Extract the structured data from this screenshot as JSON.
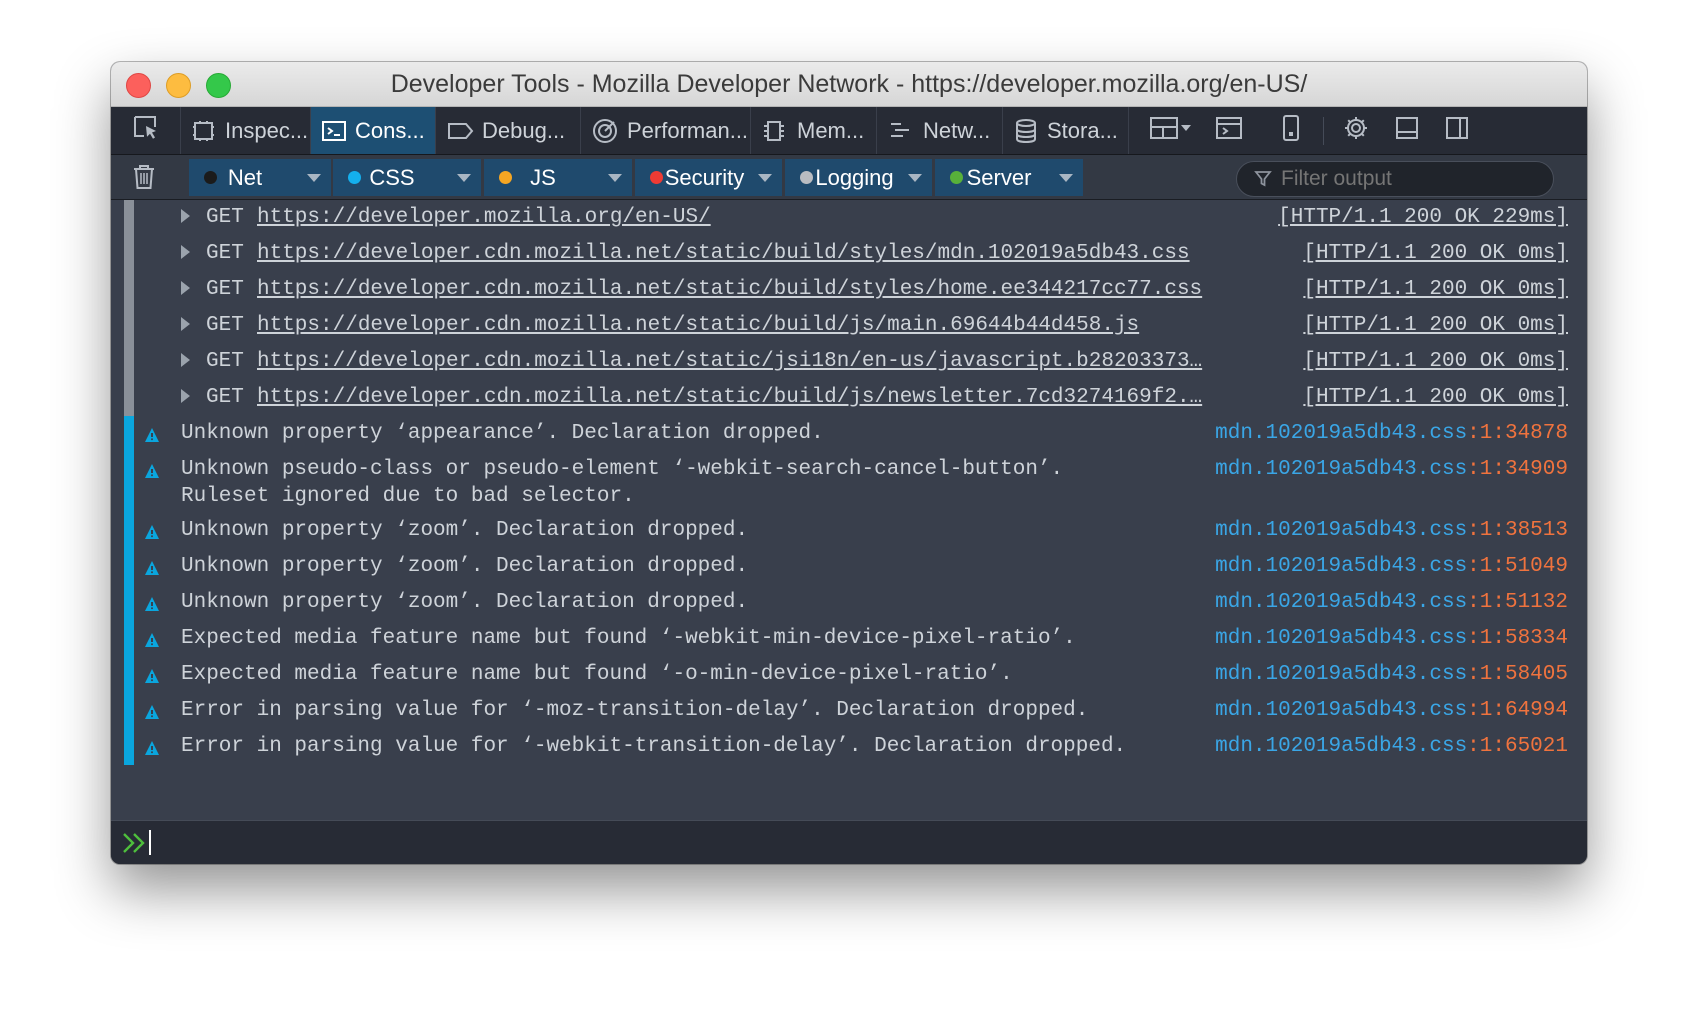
{
  "window": {
    "title": "Developer Tools - Mozilla Developer Network - https://developer.mozilla.org/en-US/"
  },
  "toolbar": {
    "tabs": [
      {
        "label": "Inspec...",
        "icon": "inspector-icon"
      },
      {
        "label": "Cons...",
        "icon": "console-icon",
        "active": true
      },
      {
        "label": "Debug...",
        "icon": "debugger-icon"
      },
      {
        "label": "Performan...",
        "icon": "performance-icon"
      },
      {
        "label": "Mem...",
        "icon": "memory-icon"
      },
      {
        "label": "Netw...",
        "icon": "network-icon"
      },
      {
        "label": "Stora...",
        "icon": "storage-icon"
      }
    ],
    "right_icons": [
      "responsive-layout-icon",
      "split-console-icon",
      "mobile-device-icon",
      "gear-icon",
      "dock-bottom-icon",
      "dock-side-icon"
    ]
  },
  "filters": {
    "buttons": [
      {
        "label": "Net",
        "dot_color": "#1b1b1b"
      },
      {
        "label": "CSS",
        "dot_color": "#14b0ee"
      },
      {
        "label": "JS",
        "dot_color": "#f5a623"
      },
      {
        "label": "Security",
        "dot_color": "#ee3b34"
      },
      {
        "label": "Logging",
        "dot_color": "#b9bcc1"
      },
      {
        "label": "Server",
        "dot_color": "#58b03a"
      }
    ],
    "search_placeholder": "Filter output"
  },
  "network_requests": [
    {
      "method": "GET",
      "url": "https://developer.mozilla.org/en-US/",
      "status": "[HTTP/1.1 200 OK 229ms]"
    },
    {
      "method": "GET",
      "url": "https://developer.cdn.mozilla.net/static/build/styles/mdn.102019a5db43.css",
      "status": "[HTTP/1.1 200 OK 0ms]"
    },
    {
      "method": "GET",
      "url": "https://developer.cdn.mozilla.net/static/build/styles/home.ee344217cc77.css",
      "status": "[HTTP/1.1 200 OK 0ms]"
    },
    {
      "method": "GET",
      "url": "https://developer.cdn.mozilla.net/static/build/js/main.69644b44d458.js",
      "status": "[HTTP/1.1 200 OK 0ms]"
    },
    {
      "method": "GET",
      "url": "https://developer.cdn.mozilla.net/static/jsi18n/en-us/javascript.b28203373…",
      "status": "[HTTP/1.1 200 OK 0ms]"
    },
    {
      "method": "GET",
      "url": "https://developer.cdn.mozilla.net/static/build/js/newsletter.7cd3274169f2.…",
      "status": "[HTTP/1.1 200 OK 0ms]"
    }
  ],
  "warnings": [
    {
      "text": "Unknown property ‘appearance’. Declaration dropped.",
      "file": "mdn.102019a5db43.css",
      "line": ":1:34878"
    },
    {
      "text": "Unknown pseudo-class or pseudo-element ‘-webkit-search-cancel-button’.\nRuleset ignored due to bad selector.",
      "file": "mdn.102019a5db43.css",
      "line": ":1:34909"
    },
    {
      "text": "Unknown property ‘zoom’. Declaration dropped.",
      "file": "mdn.102019a5db43.css",
      "line": ":1:38513"
    },
    {
      "text": "Unknown property ‘zoom’. Declaration dropped.",
      "file": "mdn.102019a5db43.css",
      "line": ":1:51049"
    },
    {
      "text": "Unknown property ‘zoom’. Declaration dropped.",
      "file": "mdn.102019a5db43.css",
      "line": ":1:51132"
    },
    {
      "text": "Expected media feature name but found ‘-webkit-min-device-pixel-ratio’.",
      "file": "mdn.102019a5db43.css",
      "line": ":1:58334"
    },
    {
      "text": "Expected media feature name but found ‘-o-min-device-pixel-ratio’.",
      "file": "mdn.102019a5db43.css",
      "line": ":1:58405"
    },
    {
      "text": "Error in parsing value for ‘-moz-transition-delay’. Declaration dropped.",
      "file": "mdn.102019a5db43.css",
      "line": ":1:64994"
    },
    {
      "text": "Error in parsing value for ‘-webkit-transition-delay’. Declaration dropped.",
      "file": "mdn.102019a5db43.css",
      "line": ":1:65021"
    }
  ],
  "colors": {
    "warning_gutter": "#0aa6de",
    "link": "#3aa6e6",
    "line_number": "#f0733e",
    "active_tab": "#1d4f73"
  }
}
